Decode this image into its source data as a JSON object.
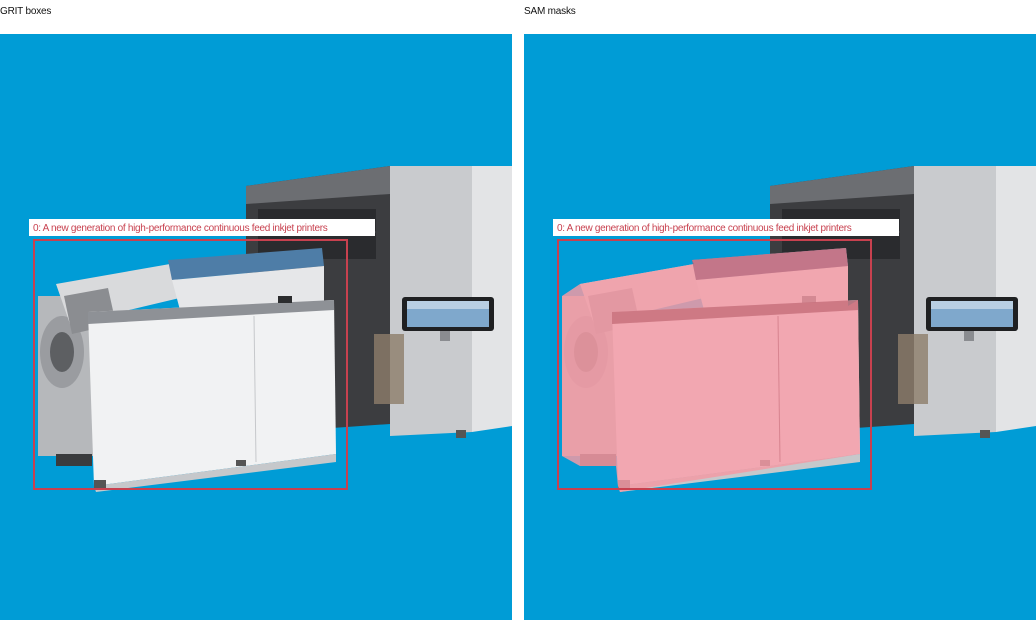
{
  "panels": [
    {
      "title": "GRIT boxes"
    },
    {
      "title": "SAM masks"
    }
  ],
  "detection": {
    "label": "0: A new generation of high-performance continuous feed inkjet printers"
  },
  "colors": {
    "background": "#009cd6",
    "box": "#c8414f",
    "mask": "#f29aa4",
    "label_bg": "#ffffff"
  }
}
